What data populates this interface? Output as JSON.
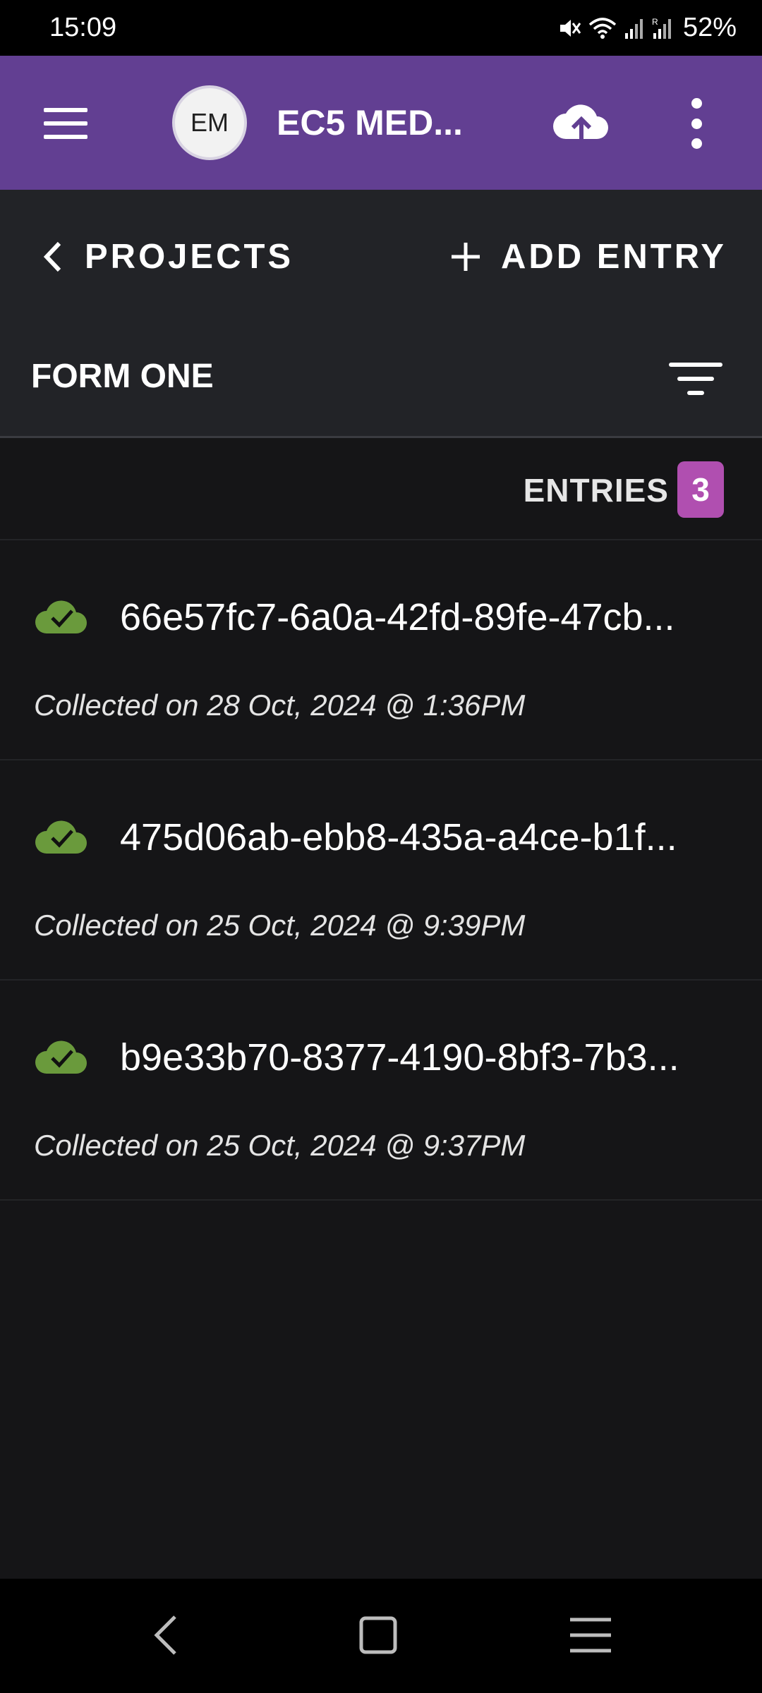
{
  "status_bar": {
    "time": "15:09",
    "battery": "52%",
    "icons": [
      "mute-icon",
      "wifi-icon",
      "signal-icon",
      "roaming-signal-icon"
    ]
  },
  "app_bar": {
    "avatar_initials": "EM",
    "project_title": "EC5 MED...",
    "accent_color": "#623f92",
    "icons": [
      "hamburger-menu-icon",
      "cloud-upload-icon",
      "more-vert-icon"
    ]
  },
  "toolbar": {
    "back_label": "PROJECTS",
    "add_entry_label": "ADD ENTRY",
    "form_title": "FORM ONE",
    "icons": [
      "chevron-left-icon",
      "plus-icon",
      "filter-icon"
    ]
  },
  "entries": {
    "label": "ENTRIES",
    "count": "3",
    "badge_color": "#b04fb0",
    "items": [
      {
        "title": "66e57fc7-6a0a-42fd-89fe-47cb...",
        "collected": "Collected on 28 Oct, 2024 @ 1:36PM",
        "status_icon": "cloud-synced-icon"
      },
      {
        "title": "475d06ab-ebb8-435a-a4ce-b1f...",
        "collected": "Collected on 25 Oct, 2024 @ 9:39PM",
        "status_icon": "cloud-synced-icon"
      },
      {
        "title": "b9e33b70-8377-4190-8bf3-7b3...",
        "collected": "Collected on 25 Oct, 2024 @ 9:37PM",
        "status_icon": "cloud-synced-icon"
      }
    ],
    "synced_color": "#6a9a3c"
  },
  "nav_bar": {
    "icons": [
      "nav-back-icon",
      "nav-home-icon",
      "nav-recents-icon"
    ]
  }
}
